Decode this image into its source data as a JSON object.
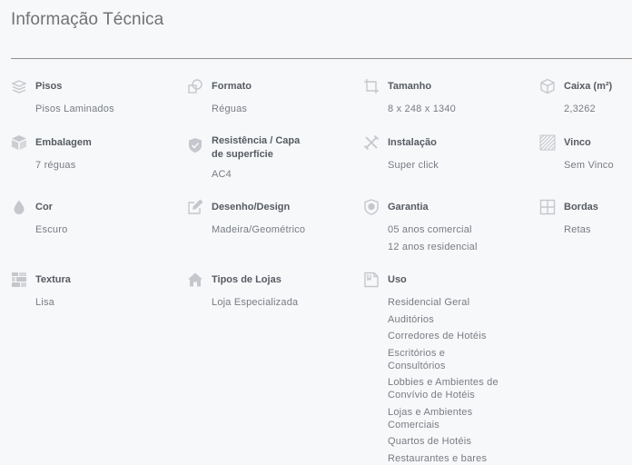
{
  "header": {
    "title": "Informação Técnica"
  },
  "specs": [
    {
      "label": "Pisos",
      "values": [
        "Pisos Laminados"
      ],
      "icon": "layers-icon"
    },
    {
      "label": "Formato",
      "values": [
        "Réguas"
      ],
      "icon": "shapes-icon"
    },
    {
      "label": "Tamanho",
      "values": [
        "8 x 248 x 1340"
      ],
      "icon": "crop-icon"
    },
    {
      "label": "Caixa (m²)",
      "values": [
        "2,3262"
      ],
      "icon": "box-icon"
    },
    {
      "label": "Embalagem",
      "values": [
        "7 réguas"
      ],
      "icon": "package-icon"
    },
    {
      "label": "Resistência / Capa de superfície",
      "values": [
        "AC4"
      ],
      "icon": "shield-check-icon"
    },
    {
      "label": "Instalação",
      "values": [
        "Super click"
      ],
      "icon": "tools-icon"
    },
    {
      "label": "Vinco",
      "values": [
        "Sem Vinco"
      ],
      "icon": "hatch-icon"
    },
    {
      "label": "Cor",
      "values": [
        "Escuro"
      ],
      "icon": "drop-icon"
    },
    {
      "label": "Desenho/Design",
      "values": [
        "Madeira/Geométrico"
      ],
      "icon": "pencil-icon"
    },
    {
      "label": "Garantia",
      "values": [
        "05 anos comercial",
        "12 anos residencial"
      ],
      "icon": "shield-icon"
    },
    {
      "label": "Bordas",
      "values": [
        "Retas"
      ],
      "icon": "grid-icon"
    },
    {
      "label": "Textura",
      "values": [
        "Lisa"
      ],
      "icon": "texture-icon"
    },
    {
      "label": "Tipos de Lojas",
      "values": [
        "Loja Especializada"
      ],
      "icon": "house-icon"
    },
    {
      "label": "Uso",
      "values": [
        "Residencial Geral",
        "Auditórios",
        "Corredores de Hotéis",
        "Escritórios e Consultórios",
        "Lobbies e Ambientes de Convívio de Hotéis",
        "Lojas e Ambientes Comerciais",
        "Quartos de Hotéis",
        "Restaurantes e bares"
      ],
      "icon": "document-icon"
    }
  ],
  "colors": {
    "text_label": "#555b62",
    "text_value": "#777c83",
    "icon": "#c4c7cc",
    "divider": "#8e8e8e",
    "background": "#f7f8fa"
  }
}
